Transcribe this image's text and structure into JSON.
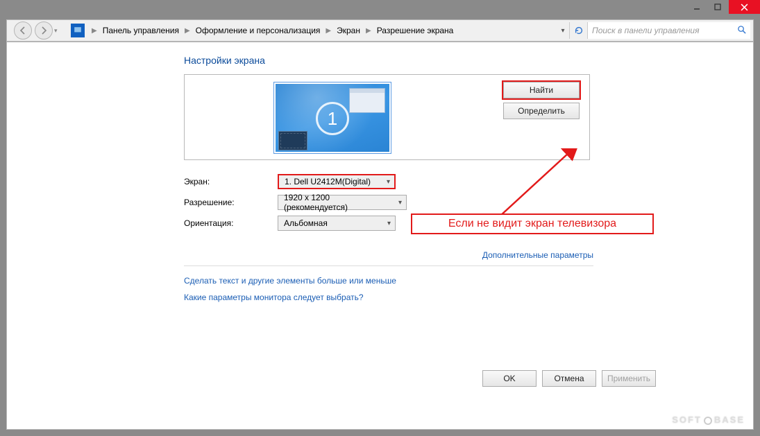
{
  "breadcrumb": {
    "items": [
      "Панель управления",
      "Оформление и персонализация",
      "Экран",
      "Разрешение экрана"
    ]
  },
  "search": {
    "placeholder": "Поиск в панели управления"
  },
  "page": {
    "title": "Настройки экрана"
  },
  "preview": {
    "display_number": "1",
    "buttons": {
      "detect": "Найти",
      "identify": "Определить"
    }
  },
  "form": {
    "display_label": "Экран:",
    "display_value": "1. Dell U2412M(Digital)",
    "resolution_label": "Разрешение:",
    "resolution_value": "1920 x 1200 (рекомендуется)",
    "orientation_label": "Ориентация:",
    "orientation_value": "Альбомная"
  },
  "links": {
    "advanced": "Дополнительные параметры",
    "text_size": "Сделать текст и другие элементы больше или меньше",
    "which_settings": "Какие параметры монитора следует выбрать?"
  },
  "buttons": {
    "ok": "OK",
    "cancel": "Отмена",
    "apply": "Применить"
  },
  "annotation": {
    "callout_text": "Если не видит экран телевизора"
  },
  "watermark": {
    "left": "SOFT",
    "right": "BASE"
  },
  "colors": {
    "accent_red": "#e21a1a",
    "link_blue": "#1a5db4"
  }
}
